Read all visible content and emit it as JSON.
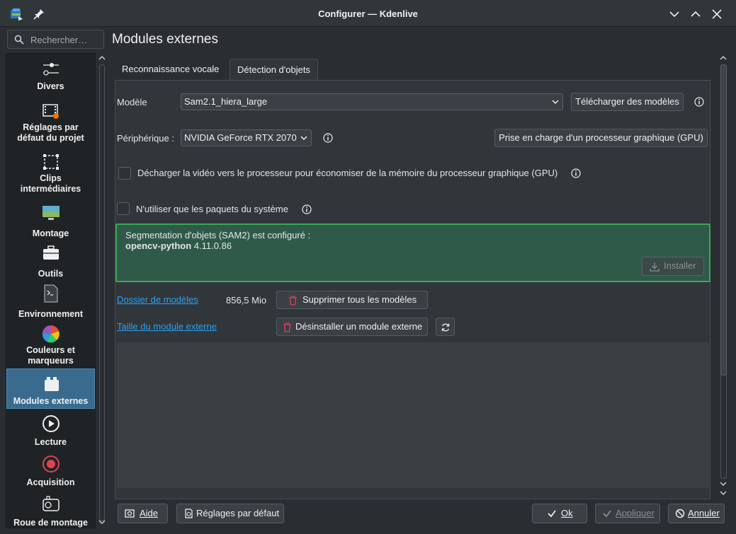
{
  "window": {
    "title": "Configurer — Kdenlive"
  },
  "search": {
    "placeholder": "Rechercher…"
  },
  "page_title": "Modules externes",
  "sidebar": {
    "items": [
      {
        "label1": "Divers",
        "label2": "",
        "icon": "sliders-icon"
      },
      {
        "label1": "Réglages par",
        "label2": "défaut du projet",
        "icon": "film-settings-icon"
      },
      {
        "label1": "Clips",
        "label2": "intermédiaires",
        "icon": "proxy-clips-icon"
      },
      {
        "label1": "Montage",
        "label2": "",
        "icon": "monitor-icon"
      },
      {
        "label1": "Outils",
        "label2": "",
        "icon": "toolbox-icon"
      },
      {
        "label1": "Environnement",
        "label2": "",
        "icon": "terminal-icon"
      },
      {
        "label1": "Couleurs et",
        "label2": "marqueurs",
        "icon": "color-wheel-icon"
      },
      {
        "label1": "Modules externes",
        "label2": "",
        "icon": "plugin-icon"
      },
      {
        "label1": "Lecture",
        "label2": "",
        "icon": "play-icon"
      },
      {
        "label1": "Acquisition",
        "label2": "",
        "icon": "record-icon"
      },
      {
        "label1": "Roue de montage",
        "label2": "",
        "icon": "jog-wheel-icon"
      }
    ],
    "active_index": 7
  },
  "tabs": [
    {
      "label": "Reconnaissance vocale"
    },
    {
      "label": "Détection d'objets"
    }
  ],
  "active_tab": 1,
  "form": {
    "model_label": "Modèle",
    "model_value": "Sam2.1_hiera_large",
    "download_models": "Télécharger des modèles",
    "device_label": "Périphérique :",
    "device_value": "NVIDIA GeForce RTX 2070",
    "gpu_support": "Prise en charge d'un processeur graphique (GPU)",
    "offload_label": "Décharger la vidéo vers le processeur pour économiser de la mémoire du processeur graphique (GPU)",
    "system_packages_label": "N'utiliser que les paquets du système"
  },
  "status_box": {
    "line1": "Segmentation d'objets (SAM2) est configuré :",
    "package_name": "opencv-python",
    "package_version": "4.11.0.86",
    "install": "Installer"
  },
  "models": {
    "folder_link": "Dossier de modèles",
    "size": "856,5 Mio",
    "delete_all": "Supprimer tous les modèles",
    "module_size_link": "Taille du module externe",
    "uninstall": "Désinstaller un module externe"
  },
  "footer": {
    "help": "Aide",
    "defaults": "Réglages par défaut",
    "ok": "Ok",
    "apply": "Appliquer",
    "cancel": "Annuler"
  },
  "colors": {
    "accent": "#3a6b8f",
    "status_border": "#3aa656",
    "status_bg": "#2f5a4a",
    "link": "#2c9ff0",
    "danger": "#da4453"
  }
}
